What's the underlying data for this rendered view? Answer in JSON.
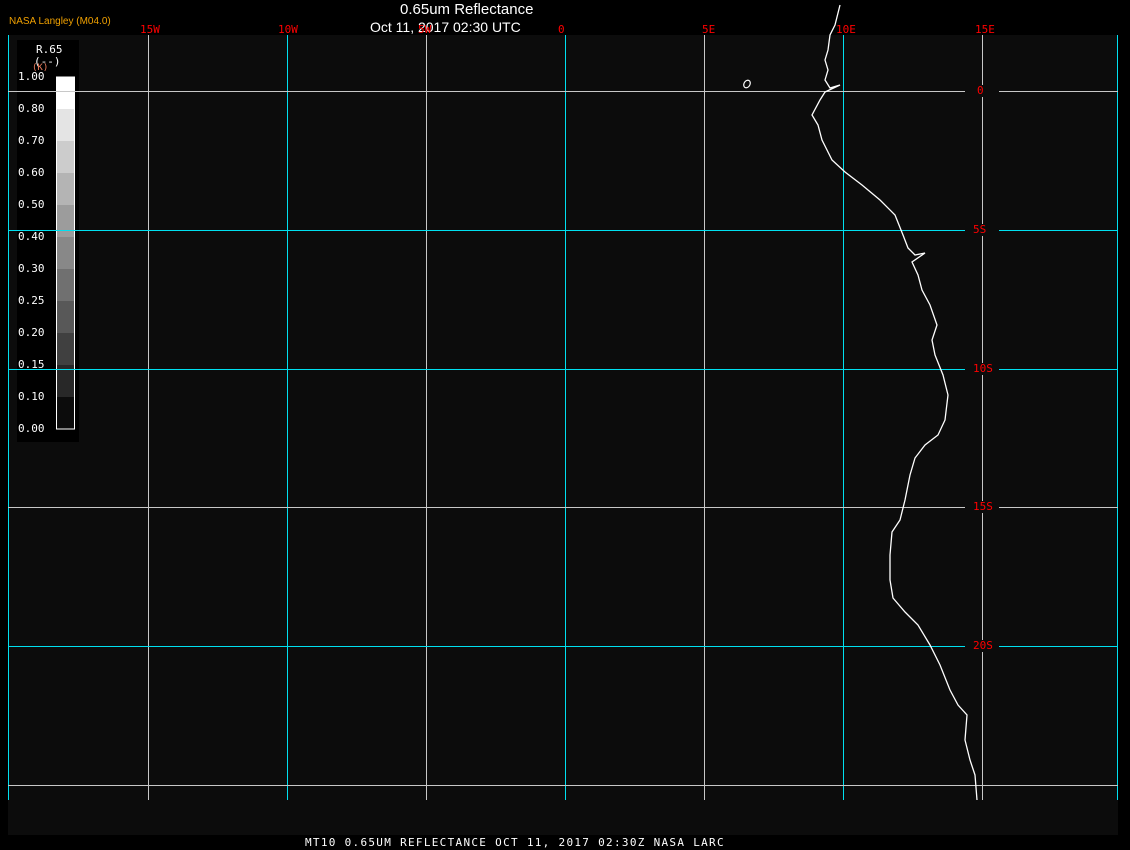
{
  "header": {
    "title": "0.65um Reflectance",
    "subtitle": "Oct 11, 2017 02:30 UTC",
    "brand": "NASA Langley (M04.0)"
  },
  "footer": {
    "caption": "MT10  0.65UM REFLECTANCE   OCT 11, 2017 02:30Z   NASA LARC"
  },
  "legend": {
    "title": "R.65",
    "units": "(--)",
    "sub_units": "(K)",
    "labels": [
      "1.00",
      "0.80",
      "0.70",
      "0.60",
      "0.50",
      "0.40",
      "0.30",
      "0.25",
      "0.20",
      "0.15",
      "0.10",
      "0.00"
    ],
    "swatch_colors": [
      "#ffffff",
      "#e4e4e4",
      "#cccccc",
      "#b4b4b4",
      "#9c9c9c",
      "#888888",
      "#707070",
      "#585858",
      "#404040",
      "#282828",
      "#0c0c0c"
    ]
  },
  "grid": {
    "longitude_labels": [
      "15W",
      "10W",
      "5W",
      "0",
      "5E",
      "10E",
      "15E"
    ],
    "latitude_labels": [
      "0",
      "5S",
      "10S",
      "15S",
      "20S"
    ],
    "line_color_primary": "#00e0f0",
    "line_color_secondary": "#c8c8c8",
    "label_color": "#ff0000"
  },
  "map": {
    "background": "#0c0c0c",
    "coastline_color": "#ffffff"
  }
}
